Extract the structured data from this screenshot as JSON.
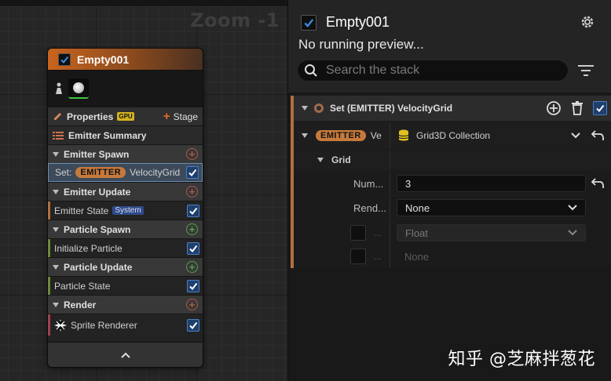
{
  "graph": {
    "zoom_label": "Zoom -1",
    "node": {
      "title": "Empty001",
      "properties_label": "Properties",
      "gpu_badge": "GPU",
      "stage_label": "Stage",
      "summary_label": "Emitter Summary",
      "sections": {
        "emitter_spawn": "Emitter Spawn",
        "emitter_update": "Emitter Update",
        "particle_spawn": "Particle Spawn",
        "particle_update": "Particle Update",
        "render": "Render"
      },
      "modules": {
        "set_prefix": "Set:",
        "set_badge": "EMITTER",
        "set_name": "VelocityGrid",
        "emitter_state": "Emitter State",
        "emitter_state_badge": "System",
        "initialize_particle": "Initialize Particle",
        "particle_state": "Particle State",
        "sprite_renderer": "Sprite Renderer"
      }
    }
  },
  "panel": {
    "title": "Empty001",
    "preview_status": "No running preview...",
    "search_placeholder": "Search the stack",
    "module_title": "Set (EMITTER) VelocityGrid",
    "emitter_badge": "EMITTER",
    "emitter_truncated": "Ve",
    "collection": "Grid3D Collection",
    "grid_label": "Grid",
    "num_label": "Num...",
    "num_value": "3",
    "rend_label": "Rend...",
    "rend_value": "None",
    "dots_1": "...",
    "type_value": "Float",
    "dots_2": "...",
    "none_value": "None"
  },
  "watermark": "知乎 @芝麻拌葱花",
  "colors": {
    "accent_orange": "#c8641e",
    "checkbox_blue": "#3a7fd5",
    "add_red": "#b0584a",
    "add_green": "#55a24a"
  }
}
